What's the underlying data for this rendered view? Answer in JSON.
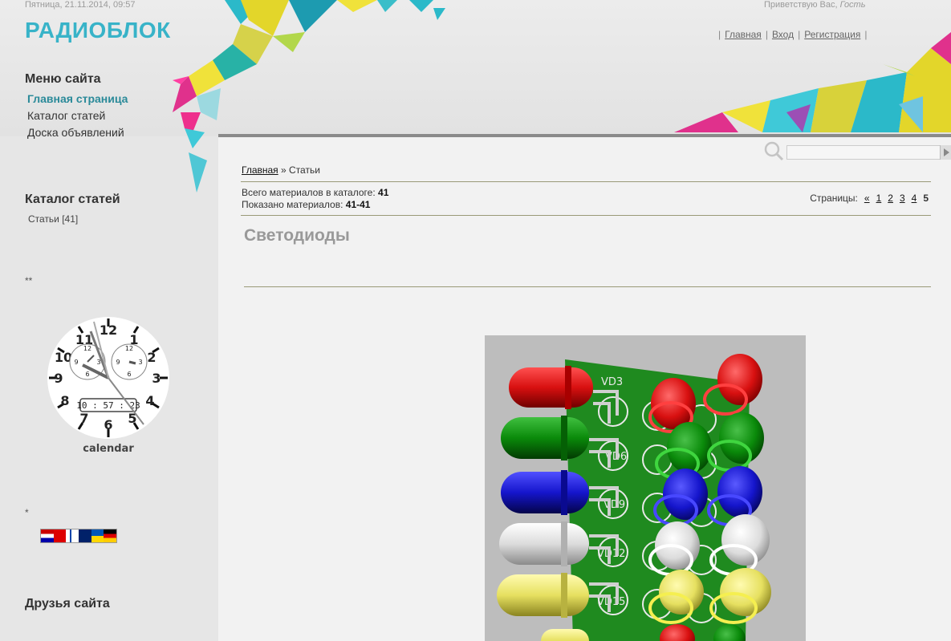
{
  "header": {
    "date": "Пятница, 21.11.2014, 09:57",
    "greeting_prefix": "Приветствую Вас,",
    "greeting_user": "Гость",
    "site_name": "РАДИОБЛОК",
    "nav": [
      "Главная",
      "Вход",
      "Регистрация"
    ]
  },
  "sidebar": {
    "menu_title": "Меню сайта",
    "menu_items": [
      "Главная страница",
      "Каталог статей",
      "Доска объявлений"
    ],
    "catalog_title": "Каталог статей",
    "catalog_item": "Статьи [41]",
    "stars1": "**",
    "clock_time": "10 : 57 : 23",
    "clock_label": "calendar",
    "stars2": "*",
    "friends_title": "Друзья сайта"
  },
  "main": {
    "breadcrumb_home": "Главная",
    "breadcrumb_sep": " » ",
    "breadcrumb_current": "Статьи",
    "total_label": "Всего материалов в каталоге:",
    "total_value": "41",
    "shown_label": "Показано материалов:",
    "shown_value": "41-41",
    "pages_label": "Страницы:",
    "pages_prev": "«",
    "pages": [
      "1",
      "2",
      "3",
      "4"
    ],
    "page_current": "5",
    "category_title": "Светодиоды",
    "photo_labels": [
      "VD3",
      "VD6",
      "VD9",
      "VD12",
      "VD15"
    ]
  },
  "colors": {
    "logo": "#38b3c8",
    "menu_active": "#2a8a99",
    "led_red": "#d81010",
    "led_green": "#0a8a0a",
    "led_blue": "#1515cc",
    "led_white": "#e8e8e8",
    "led_yellow": "#e6e060",
    "pcb": "#1f8a1f"
  }
}
